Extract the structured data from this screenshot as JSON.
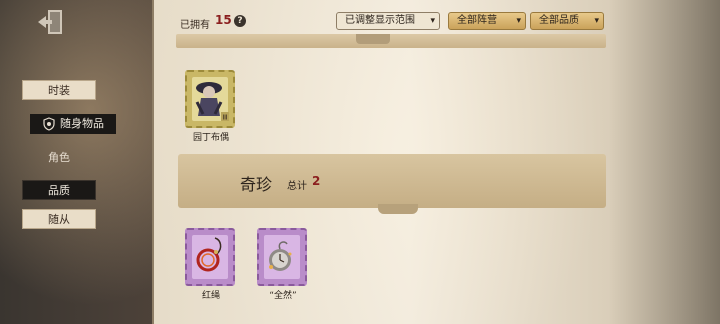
{
  "header": {
    "owned_label": "已拥有",
    "owned_count": "15",
    "help_symbol": "?",
    "filters": [
      {
        "label": "已调整显示范围",
        "chevron": "▾"
      },
      {
        "label": "全部阵营",
        "chevron": "▾"
      },
      {
        "label": "全部品质",
        "chevron": "▾"
      }
    ]
  },
  "sidebar": {
    "items": [
      {
        "label": "时装"
      },
      {
        "label": "随身物品"
      },
      {
        "label": "角色"
      },
      {
        "label": "品质"
      },
      {
        "label": "随从"
      }
    ]
  },
  "sections": [
    {
      "items": [
        {
          "label": "园丁布偶",
          "icon": "doll-icon",
          "badge": "Ⅲ"
        }
      ]
    },
    {
      "title": "奇珍",
      "total_label": "总计",
      "total": "2",
      "items": [
        {
          "label": "红绳",
          "icon": "red-cord-icon"
        },
        {
          "label": "“全然”",
          "icon": "pocket-watch-icon"
        }
      ]
    }
  ],
  "colors": {
    "accent_red": "#8b1f1f",
    "stamp_gold": "#c9b766",
    "stamp_purple": "#b98cc9"
  }
}
